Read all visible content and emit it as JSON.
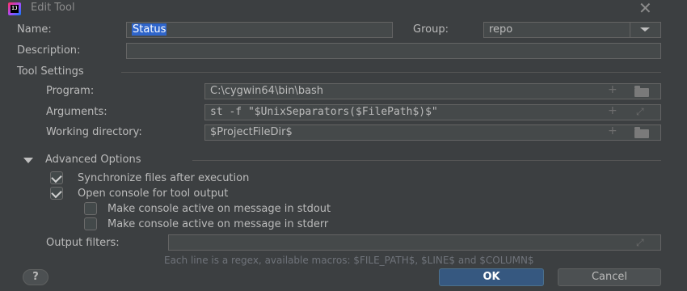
{
  "window": {
    "title": "Edit Tool",
    "close_glyph": "✕",
    "app_icon_text": "IJ"
  },
  "form": {
    "name_label": "Name:",
    "name_value": "Status",
    "group_label": "Group:",
    "group_value": "repo",
    "description_label": "Description:",
    "description_value": ""
  },
  "tool_settings": {
    "title": "Tool Settings",
    "program_label": "Program:",
    "program_value": "C:\\cygwin64\\bin\\bash",
    "arguments_label": "Arguments:",
    "arguments_value": "st -f \"$UnixSeparators($FilePath$)$\"",
    "working_dir_label": "Working directory:",
    "working_dir_value": "$ProjectFileDir$"
  },
  "advanced": {
    "title": "Advanced Options",
    "sync_files_label": "Synchronize files after execution",
    "sync_files_checked": true,
    "open_console_label": "Open console for tool output",
    "open_console_checked": true,
    "active_stdout_label": "Make console active on message in stdout",
    "active_stdout_checked": false,
    "active_stderr_label": "Make console active on message in stderr",
    "active_stderr_checked": false,
    "output_filters_label": "Output filters:",
    "output_filters_value": "",
    "hint": "Each line is a regex, available macros: $FILE_PATH$, $LINE$ and $COLUMN$"
  },
  "buttons": {
    "help": "?",
    "ok": "OK",
    "cancel": "Cancel"
  },
  "icons": {
    "plus": "+",
    "expand": "⤢",
    "folder": "folder-icon",
    "dropdown": "chevron-down-icon"
  },
  "colors": {
    "background": "#3c3f41",
    "field": "#45494a",
    "selection": "#2f65ca",
    "ok_button": "#365880"
  }
}
